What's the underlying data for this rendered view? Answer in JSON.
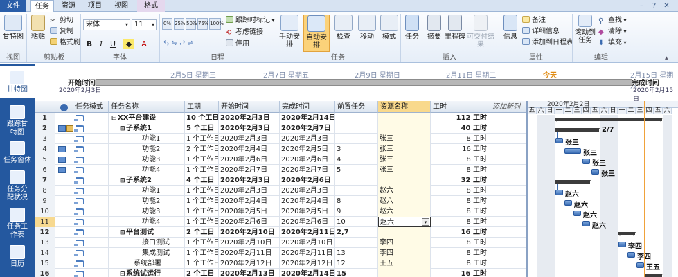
{
  "tabs": [
    {
      "label": "文件"
    },
    {
      "label": "任务"
    },
    {
      "label": "资源"
    },
    {
      "label": "项目"
    },
    {
      "label": "视图"
    },
    {
      "label": "格式"
    }
  ],
  "ribbon": {
    "view": {
      "gantt_label": "甘特图",
      "group": "视图"
    },
    "clipboard": {
      "paste": "粘贴",
      "cut": "剪切",
      "copy": "复制",
      "format_painter": "格式刷",
      "group": "剪贴板"
    },
    "font": {
      "family": "宋体",
      "size": "11",
      "bold": "B",
      "italic": "I",
      "underline": "U",
      "group": "字体"
    },
    "schedule": {
      "track": "跟踪时标记",
      "respect_links": "考虑链接",
      "inactivate": "停用",
      "pct": [
        "0%",
        "25%",
        "50%",
        "75%",
        "100%"
      ],
      "group": "日程"
    },
    "tasks": {
      "manual": "手动安排",
      "auto": "自动安排",
      "inspect": "检查",
      "move": "移动",
      "mode": "模式",
      "group": "任务"
    },
    "insert": {
      "task": "任务",
      "summary": "摘要",
      "milestone": "里程碑",
      "deliverable": "可交付结果",
      "group": "插入"
    },
    "properties": {
      "info": "信息",
      "notes": "备注",
      "details": "详细信息",
      "add_timeline": "添加到日程表",
      "group": "属性"
    },
    "editing": {
      "scroll": "滚动到",
      "scroll2": "任务",
      "find": "查找",
      "clear": "清除",
      "fill": "填充",
      "group": "编辑"
    }
  },
  "sidebar": [
    {
      "label": "甘特图"
    },
    {
      "label": "跟踪甘特图"
    },
    {
      "label": "任务窗体"
    },
    {
      "label": "任务分配状况"
    },
    {
      "label": "任务工作表"
    },
    {
      "label": "日历"
    }
  ],
  "timeline": {
    "start_label": "开始时间",
    "start_date": "2020年2月3日",
    "finish_label": "完成时间",
    "finish_date": "2020年2月15日",
    "today": "今天",
    "dates": [
      "2月5日 星期三",
      "2月7日 星期五",
      "2月9日 星期日",
      "2月11日 星期二",
      "2月13日 星期四",
      "2月15日 星期六"
    ]
  },
  "grid": {
    "headers": {
      "mode": "任务模式",
      "name": "任务名称",
      "duration": "工期",
      "start": "开始时间",
      "finish": "完成时间",
      "pred": "前置任务",
      "resource": "资源名称",
      "work": "工时",
      "add": "添加新列"
    },
    "rows": [
      {
        "id": "1",
        "name": "XX平台建设",
        "level": 0,
        "summary": true,
        "duration": "10 个工日",
        "start": "2020年2月3日",
        "finish": "2020年2月14日",
        "pred": "",
        "resource": "",
        "work": "112 工时"
      },
      {
        "id": "2",
        "name": "子系统1",
        "level": 1,
        "summary": true,
        "duration": "5 个工日",
        "start": "2020年2月3日",
        "finish": "2020年2月7日",
        "pred": "",
        "resource": "",
        "work": "40 工时"
      },
      {
        "id": "3",
        "name": "功能1",
        "level": 2,
        "summary": false,
        "duration": "1 个工作日",
        "start": "2020年2月3日",
        "finish": "2020年2月3日",
        "pred": "",
        "resource": "张三",
        "work": "8 工时"
      },
      {
        "id": "4",
        "name": "功能2",
        "level": 2,
        "summary": false,
        "duration": "2 个工作日",
        "start": "2020年2月4日",
        "finish": "2020年2月5日",
        "pred": "3",
        "resource": "张三",
        "work": "16 工时"
      },
      {
        "id": "5",
        "name": "功能3",
        "level": 2,
        "summary": false,
        "duration": "1 个工作日",
        "start": "2020年2月6日",
        "finish": "2020年2月6日",
        "pred": "4",
        "resource": "张三",
        "work": "8 工时"
      },
      {
        "id": "6",
        "name": "功能4",
        "level": 2,
        "summary": false,
        "duration": "1 个工作日",
        "start": "2020年2月7日",
        "finish": "2020年2月7日",
        "pred": "5",
        "resource": "张三",
        "work": "8 工时"
      },
      {
        "id": "7",
        "name": "子系统2",
        "level": 1,
        "summary": true,
        "duration": "4 个工日",
        "start": "2020年2月3日",
        "finish": "2020年2月6日",
        "pred": "",
        "resource": "",
        "work": "32 工时"
      },
      {
        "id": "8",
        "name": "功能1",
        "level": 2,
        "summary": false,
        "duration": "1 个工作日",
        "start": "2020年2月3日",
        "finish": "2020年2月3日",
        "pred": "",
        "resource": "赵六",
        "work": "8 工时"
      },
      {
        "id": "9",
        "name": "功能2",
        "level": 2,
        "summary": false,
        "duration": "1 个工作日",
        "start": "2020年2月4日",
        "finish": "2020年2月4日",
        "pred": "8",
        "resource": "赵六",
        "work": "8 工时"
      },
      {
        "id": "10",
        "name": "功能3",
        "level": 2,
        "summary": false,
        "duration": "1 个工作日",
        "start": "2020年2月5日",
        "finish": "2020年2月5日",
        "pred": "9",
        "resource": "赵六",
        "work": "8 工时"
      },
      {
        "id": "11",
        "name": "功能4",
        "level": 2,
        "summary": false,
        "duration": "1 个工作日",
        "start": "2020年2月6日",
        "finish": "2020年2月6日",
        "pred": "10",
        "resource": "赵六",
        "work": "8 工时"
      },
      {
        "id": "12",
        "name": "平台测试",
        "level": 1,
        "summary": true,
        "duration": "2 个工日",
        "start": "2020年2月10日",
        "finish": "2020年2月11日",
        "pred": "2,7",
        "resource": "",
        "work": "16 工时"
      },
      {
        "id": "13",
        "name": "接口测试",
        "level": 2,
        "summary": false,
        "duration": "1 个工作日",
        "start": "2020年2月10日",
        "finish": "2020年2月10日",
        "pred": "",
        "resource": "李四",
        "work": "8 工时"
      },
      {
        "id": "14",
        "name": "集成测试",
        "level": 2,
        "summary": false,
        "duration": "1 个工作日",
        "start": "2020年2月11日",
        "finish": "2020年2月11日",
        "pred": "13",
        "resource": "李四",
        "work": "8 工时"
      },
      {
        "id": "15",
        "name": "系统部署",
        "level": 1,
        "summary": false,
        "duration": "1 个工作日",
        "start": "2020年2月12日",
        "finish": "2020年2月12日",
        "pred": "12",
        "resource": "王五",
        "work": "8 工时"
      },
      {
        "id": "16",
        "name": "系统试运行",
        "level": 1,
        "summary": true,
        "duration": "2 个工日",
        "start": "2020年2月13日",
        "finish": "2020年2月14日",
        "pred": "15",
        "resource": "",
        "work": "16 工时"
      }
    ]
  },
  "gantt": {
    "week_label": "2020年2月2日",
    "days": [
      "五",
      "六",
      "日",
      "一",
      "二",
      "三",
      "四",
      "五",
      "六",
      "日",
      "一",
      "二",
      "三",
      "四",
      "五",
      "六"
    ],
    "labels": [
      "2/7",
      "张三",
      "张三",
      "张三",
      "张三",
      "赵六",
      "赵六",
      "赵六",
      "赵六",
      "李四",
      "李四",
      "王五"
    ]
  }
}
